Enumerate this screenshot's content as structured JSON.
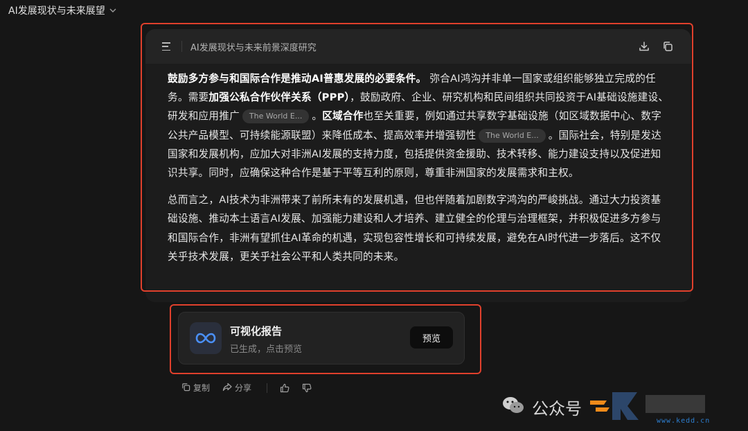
{
  "header": {
    "title": "AI发展现状与未来展望"
  },
  "document": {
    "title": "AI发展现状与未来前景深度研究",
    "paragraph1": {
      "b1": "鼓励多方参与和国际合作是推动AI普惠发展的必要条件。",
      "t1": "弥合AI鸿沟并非单一国家或组织能够独立完成的任务。需要",
      "b2": "加强公私合作伙伴关系（PPP）",
      "t2": "，鼓励政府、企业、研究机构和民间组织共同投资于AI基础设施建设、研发和应用推广",
      "cite1": "The World E...",
      "t3": "。",
      "b3": "区域合作",
      "t4": "也至关重要，例如通过共享数字基础设施（如区域数据中心、数字公共产品模型、可持续能源联盟）来降低成本、提高效率并增强韧性",
      "cite2": "The World E...",
      "t5": "。国际社会，特别是发达国家和发展机构，应加大对非洲AI发展的支持力度，包括提供资金援助、技术转移、能力建设支持以及促进知识共享。同时，应确保这种合作是基于平等互利的原则，尊重非洲国家的发展需求和主权。"
    },
    "paragraph2": "总而言之，AI技术为非洲带来了前所未有的发展机遇，但也伴随着加剧数字鸿沟的严峻挑战。通过大力投资基础设施、推动本土语言AI发展、加强能力建设和人才培养、建立健全的伦理与治理框架，并积极促进多方参与和国际合作，非洲有望抓住AI革命的机遇，实现包容性增长和可持续发展，避免在AI时代进一步落后。这不仅关乎技术发展，更关乎社会公平和人类共同的未来。"
  },
  "report": {
    "title": "可视化报告",
    "subtitle": "已生成，点击预览",
    "button": "预览"
  },
  "actions": {
    "copy": "复制",
    "share": "分享"
  },
  "watermark": {
    "text": "公众号",
    "url": "www.kedd.cn"
  },
  "colors": {
    "highlight": "#e0402c",
    "icon_blue": "#4a8ff7"
  }
}
